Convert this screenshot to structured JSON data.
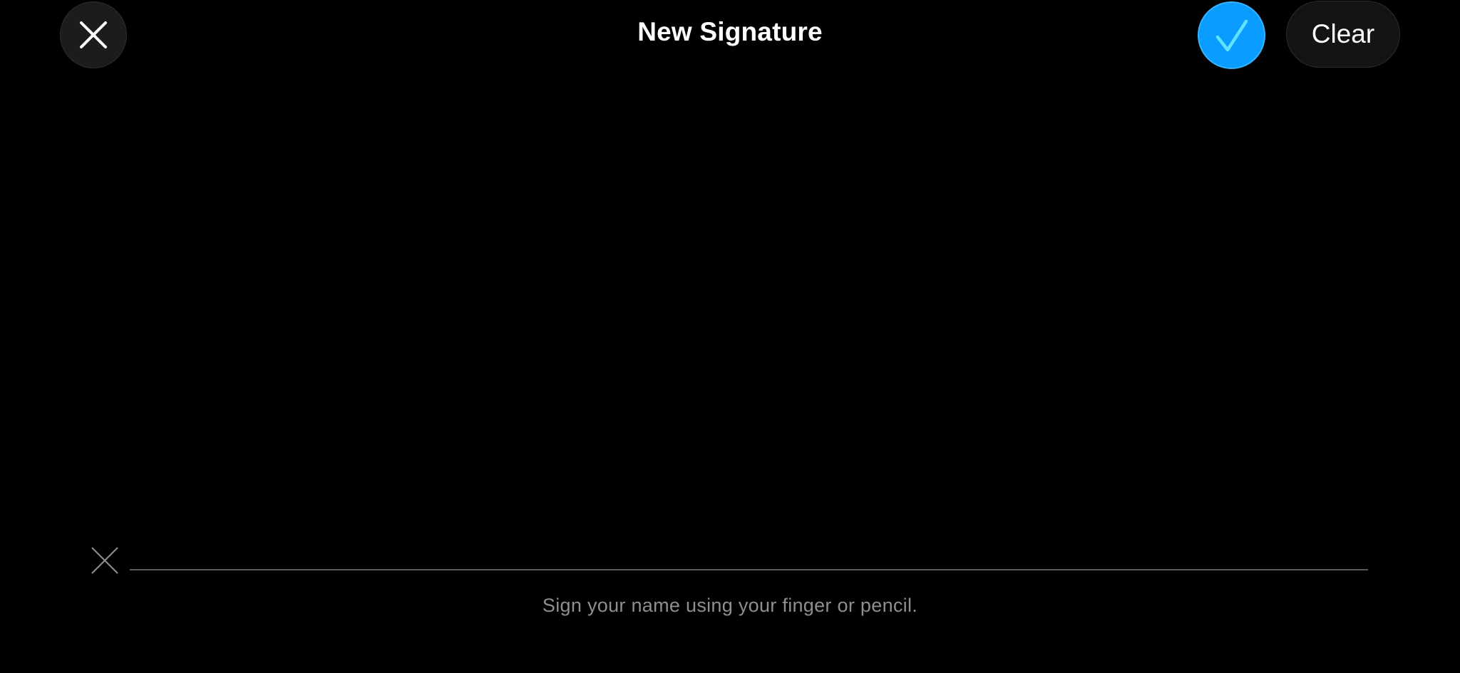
{
  "header": {
    "title": "New Signature",
    "clear_label": "Clear",
    "close_icon": "close-icon",
    "confirm_icon": "checkmark-icon"
  },
  "signature_pad": {
    "marker_icon": "x-mark-icon",
    "hint": "Sign your name using your finger or pencil."
  },
  "colors": {
    "background": "#000000",
    "accent": "#0a9cff",
    "checkmark": "#5fe3ff",
    "hint_text": "#8e8e93",
    "baseline": "#5a5a5e"
  }
}
